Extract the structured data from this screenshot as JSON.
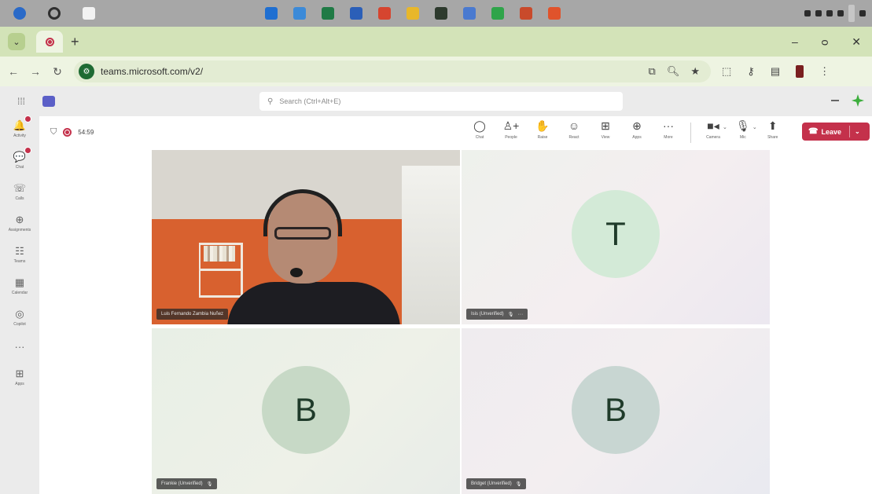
{
  "taskbar": {
    "apps": [
      {
        "name": "start-icon",
        "color": "#2a6ac8"
      },
      {
        "name": "search-icon",
        "color": "#3a3a3a"
      },
      {
        "name": "taskview-icon",
        "color": "#ffffff"
      }
    ],
    "pinned": [
      {
        "name": "outlook-icon",
        "color": "#1f6fd1"
      },
      {
        "name": "notepad-icon",
        "color": "#3c8ad8"
      },
      {
        "name": "excel-icon",
        "color": "#1f7a45"
      },
      {
        "name": "word-icon",
        "color": "#2b5fb8"
      },
      {
        "name": "chrome-icon",
        "color": "#d6452f"
      },
      {
        "name": "file-explorer-icon",
        "color": "#e8b72a"
      },
      {
        "name": "app-icon",
        "color": "#2d3a2d"
      },
      {
        "name": "network-icon",
        "color": "#4a7ad0"
      },
      {
        "name": "whatsapp-icon",
        "color": "#2fa44a"
      },
      {
        "name": "powerpoint-icon",
        "color": "#c94a2b"
      },
      {
        "name": "brave-icon",
        "color": "#e0532b"
      }
    ]
  },
  "browser": {
    "url": "teams.microsoft.com/v2/",
    "new_tab": "+",
    "window_controls": {
      "minimize": "–",
      "restore": "ᴑ",
      "close": "✕"
    }
  },
  "teams": {
    "search_placeholder": "Search (Ctrl+Alt+E)",
    "rail": [
      {
        "name": "rail-item-activity",
        "glyph": "🔔",
        "label": "Activity",
        "badge": true
      },
      {
        "name": "rail-item-chat",
        "glyph": "💬",
        "label": "Chat",
        "badge": true
      },
      {
        "name": "rail-item-calls",
        "glyph": "☏",
        "label": "Calls",
        "badge": false
      },
      {
        "name": "rail-item-assignments",
        "glyph": "⊕",
        "label": "Assignments",
        "badge": false
      },
      {
        "name": "rail-item-teams",
        "glyph": "☷",
        "label": "Teams",
        "badge": false
      },
      {
        "name": "rail-item-calendar",
        "glyph": "▦",
        "label": "Calendar",
        "badge": false
      },
      {
        "name": "rail-item-copilot",
        "glyph": "◎",
        "label": "Copilot",
        "badge": false
      },
      {
        "name": "rail-item-more",
        "glyph": "···",
        "label": "",
        "badge": false
      },
      {
        "name": "rail-item-apps",
        "glyph": "⊞",
        "label": "Apps",
        "badge": false
      }
    ],
    "meeting": {
      "timer": "54:59",
      "tools": [
        {
          "name": "chat-tool",
          "glyph": "◯",
          "label": "Chat"
        },
        {
          "name": "people-tool",
          "glyph": "♙+",
          "label": "People"
        },
        {
          "name": "raise-tool",
          "glyph": "✋",
          "label": "Raise"
        },
        {
          "name": "react-tool",
          "glyph": "☺",
          "label": "React"
        },
        {
          "name": "view-tool",
          "glyph": "⊞",
          "label": "View"
        },
        {
          "name": "apps-tool",
          "glyph": "⊕",
          "label": "Apps"
        },
        {
          "name": "more-tool",
          "glyph": "···",
          "label": "More"
        }
      ],
      "media": [
        {
          "name": "camera-tool",
          "glyph": "■◂",
          "label": "Camera"
        },
        {
          "name": "mic-tool",
          "glyph": "🎙",
          "label": "Mic"
        },
        {
          "name": "share-tool",
          "glyph": "⬆",
          "label": "Share"
        }
      ],
      "leave_label": "Leave"
    },
    "participants": [
      {
        "name": "Luis Fernando Zambia Nuñez",
        "initial": ""
      },
      {
        "name": "Isis (Unverified)",
        "initial": "T"
      },
      {
        "name": "Frankie (Unverified)",
        "initial": "B"
      },
      {
        "name": "Bridget (Unverified)",
        "initial": "B"
      }
    ]
  }
}
